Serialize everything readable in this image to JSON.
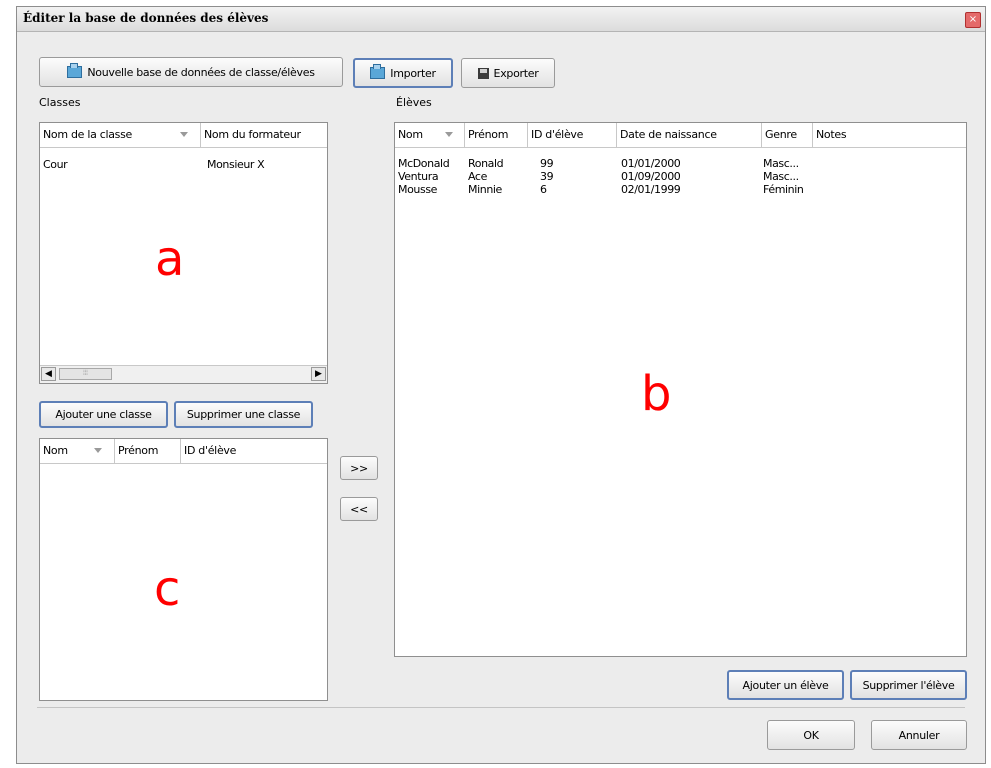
{
  "window": {
    "title": "Éditer la base de données des élèves",
    "close_glyph": "×"
  },
  "toolbar": {
    "new_db_label": "Nouvelle base de données de classe/élèves",
    "import_label": "Importer",
    "export_label": "Exporter"
  },
  "classes": {
    "section_label": "Classes",
    "columns": [
      "Nom de la classe",
      "Nom du formateur"
    ],
    "rows": [
      {
        "name": "Cour",
        "trainer": "Monsieur X"
      }
    ],
    "scroll_left": "◀",
    "scroll_right": "▶",
    "thumb_grip": "⦙⦙⦙",
    "add_label": "Ajouter une classe",
    "remove_label": "Supprimer une classe",
    "overlay_letter": "a"
  },
  "class_students": {
    "columns": [
      "Nom",
      "Prénom",
      "ID d'élève"
    ],
    "overlay_letter": "c"
  },
  "transfer": {
    "add_label": ">>",
    "remove_label": "<<"
  },
  "students": {
    "section_label": "Élèves",
    "columns": [
      "Nom",
      "Prénom",
      "ID d'élève",
      "Date de naissance",
      "Genre",
      "Notes"
    ],
    "rows": [
      {
        "nom": "McDonald",
        "prenom": "Ronald",
        "id": "99",
        "date": "01/01/2000",
        "genre": "Masc..."
      },
      {
        "nom": "Ventura",
        "prenom": "Ace",
        "id": "39",
        "date": "01/09/2000",
        "genre": "Masc..."
      },
      {
        "nom": "Mousse",
        "prenom": "Minnie",
        "id": "6",
        "date": "02/01/1999",
        "genre": "Féminin"
      }
    ],
    "add_label": "Ajouter un élève",
    "remove_label": "Supprimer l'élève",
    "overlay_letter": "b"
  },
  "footer": {
    "ok_label": "OK",
    "cancel_label": "Annuler"
  }
}
